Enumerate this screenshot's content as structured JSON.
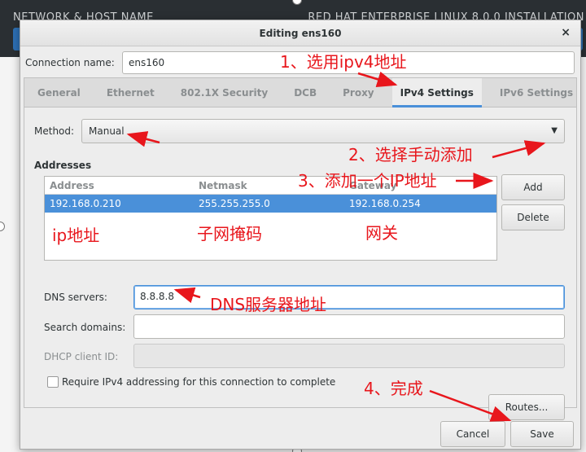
{
  "background": {
    "left_text": "NETWORK & HOST NAME",
    "right_text": "RED HAT ENTERPRISE LINUX 8.0.0 INSTALLATION"
  },
  "dialog": {
    "title": "Editing ens160",
    "close_glyph": "×",
    "connection_name_label": "Connection name:",
    "connection_name_value": "ens160"
  },
  "tabs": [
    {
      "label": "General"
    },
    {
      "label": "Ethernet"
    },
    {
      "label": "802.1X Security"
    },
    {
      "label": "DCB"
    },
    {
      "label": "Proxy"
    },
    {
      "label": "IPv4 Settings",
      "active": true
    },
    {
      "label": "IPv6 Settings"
    }
  ],
  "ipv4": {
    "method_label": "Method:",
    "method_value": "Manual",
    "addresses_heading": "Addresses",
    "columns": [
      "Address",
      "Netmask",
      "Gateway"
    ],
    "rows": [
      {
        "address": "192.168.0.210",
        "netmask": "255.255.255.0",
        "gateway": "192.168.0.254"
      }
    ],
    "add_button": "Add",
    "delete_button": "Delete",
    "dns_label": "DNS servers:",
    "dns_value": "8.8.8.8",
    "search_label": "Search domains:",
    "search_value": "",
    "dhcp_label": "DHCP client ID:",
    "dhcp_value": "",
    "require_label": "Require IPv4 addressing for this connection to complete",
    "routes_button": "Routes..."
  },
  "footer": {
    "cancel_button": "Cancel",
    "save_button": "Save"
  },
  "annotations": {
    "step1": "1、选用ipv4地址",
    "step2": "2、选择手动添加",
    "step3": "3、添加一个IP地址",
    "ip_label": "ip地址",
    "mask_label": "子网掩码",
    "gateway_label": "网关",
    "dns_note": "DNS服务器地址",
    "step4": "4、完成"
  },
  "colors": {
    "accent": "#4a90d9",
    "annotation": "#e8161c"
  }
}
